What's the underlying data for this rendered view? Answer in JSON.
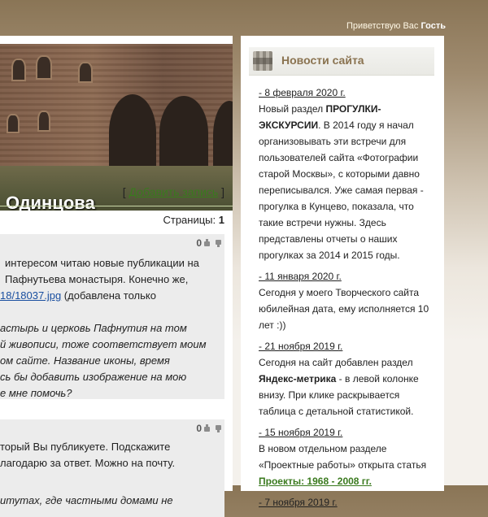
{
  "header": {
    "greeting_prefix": "Приветствую Вас",
    "greeting_user": "Гость"
  },
  "left": {
    "title": "Одинцова",
    "add_entry_open": "[",
    "add_entry_label": "Добавить запись",
    "add_entry_close": "]",
    "pages_label": "Страницы:",
    "pages_current": "1",
    "comments": [
      {
        "votes": "0",
        "lines": [
          {
            "text": "интересом читаю новые публикации на",
            "italic": false
          },
          {
            "text": "Пафнутьева монастыря. Конечно же,",
            "italic": false
          },
          {
            "link": "18/18037.jpg",
            "text": " (добавлена только",
            "italic": false
          },
          {
            "text": "",
            "italic": false
          },
          {
            "text": "астырь и церковь Пафнутия на том",
            "italic": true
          },
          {
            "text": "й живописи, тоже соответствует моим",
            "italic": true
          },
          {
            "text": "ом сайте. Название иконы, время",
            "italic": true
          },
          {
            "text": "сь бы добавить изображение на мою",
            "italic": true
          },
          {
            "text": "е мне помочь?",
            "italic": true
          }
        ]
      },
      {
        "votes": "0",
        "lines": [
          {
            "text": "торый Вы публикуете. Подскажите",
            "italic": false
          },
          {
            "text": "лагодарю за ответ. Можно на почту.",
            "italic": false
          },
          {
            "text": "",
            "italic": false
          },
          {
            "text": "итутах, где частными домами не",
            "italic": true
          }
        ]
      }
    ]
  },
  "news": {
    "title": "Новости сайта",
    "items": [
      {
        "date": "- 8 февраля 2020 г.",
        "parts": [
          {
            "t": "Новый раздел "
          },
          {
            "b": "ПРОГУЛКИ-ЭКСКУРСИИ"
          },
          {
            "t": ". В 2014 году я начал организовывать эти встречи для пользователей сайта «Фотографии старой Москвы», с которыми давно переписывался. Уже самая первая - прогулка в Кунцево, показала, что такие встречи нужны. Здесь представлены отчеты о наших прогулках за 2014 и 2015 годы."
          }
        ]
      },
      {
        "date": "- 11 января 2020 г.",
        "parts": [
          {
            "t": "Сегодня у моего Творческого сайта юбилейная дата, ему исполняется 10 лет :))"
          }
        ]
      },
      {
        "date": "- 21 ноября 2019 г.",
        "parts": [
          {
            "t": "Сегодня на сайт добавлен раздел "
          },
          {
            "b": "Яндекс-метрика"
          },
          {
            "t": " - в левой колонке внизу. При клике раскрывается таблица с детальной статистикой."
          }
        ]
      },
      {
        "date": "- 15 ноября 2019 г.",
        "parts": [
          {
            "t": "В новом отдельном разделе «Проектные работы» открыта статья"
          },
          {
            "l": " Проекты: 1968 - 2008 гг."
          }
        ]
      },
      {
        "date": "- 7 ноября 2019 г.",
        "parts": []
      }
    ]
  },
  "colors": {
    "accent_green": "#3a7a1e",
    "news_title": "#8a7350",
    "link_blue": "#1a4fa0"
  }
}
